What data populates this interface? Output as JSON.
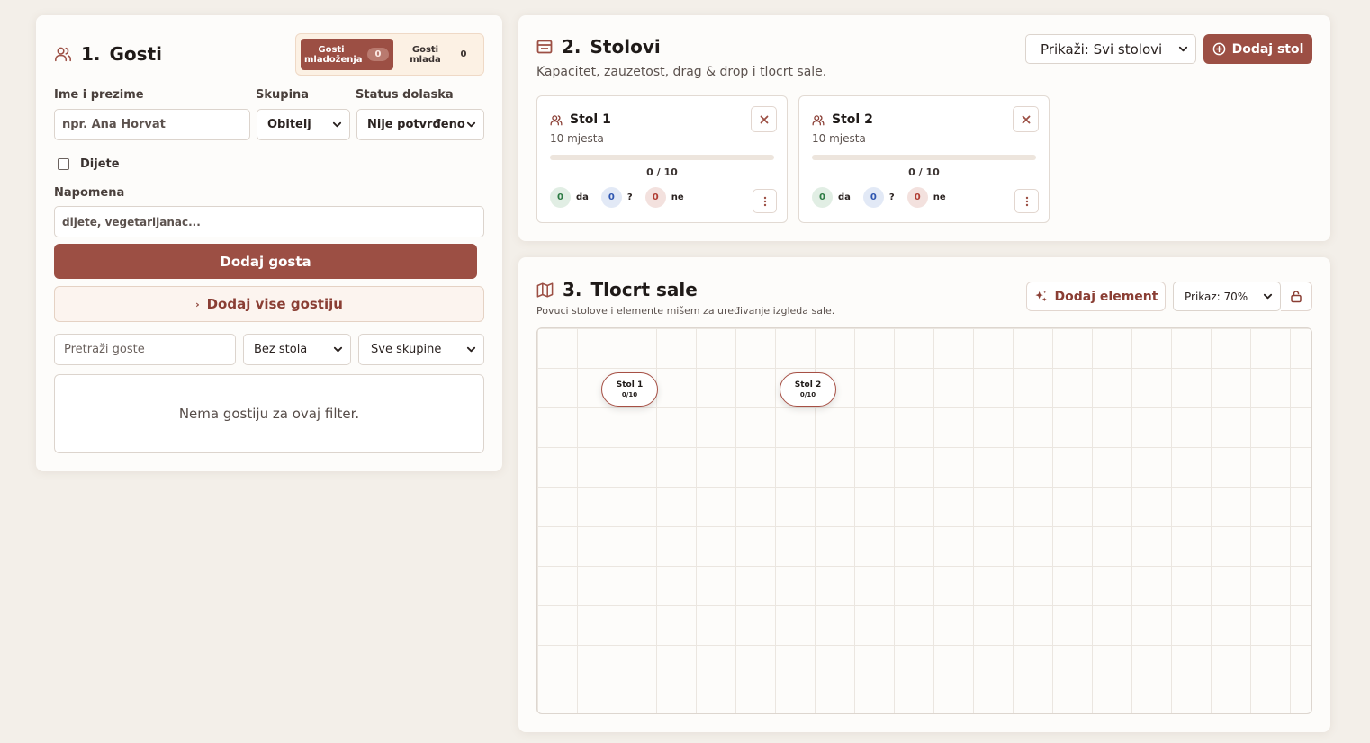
{
  "guests": {
    "number": "1.",
    "title": "Gosti",
    "tabs": [
      {
        "label": "Gosti mladoženja",
        "count": "0"
      },
      {
        "label": "Gosti mlada",
        "count": "0"
      }
    ],
    "name_label": "Ime i prezime",
    "name_placeholder": "npr. Ana Horvat",
    "group_label": "Skupina",
    "group_value": "Obitelj",
    "status_label": "Status dolaska",
    "status_value": "Nije potvrđeno",
    "child_label": "Dijete",
    "note_label": "Napomena",
    "note_placeholder": "dijete, vegetarijanac...",
    "add_button": "Dodaj gosta",
    "add_multiple_button": "Dodaj vise gostiju",
    "search_placeholder": "Pretraži goste",
    "table_filter": "Bez stola",
    "group_filter": "Sve skupine",
    "empty_text": "Nema gostiju za ovaj filter."
  },
  "tables": {
    "number": "2.",
    "title": "Stolovi",
    "subtitle": "Kapacitet, zauzetost, drag & drop i tlocrt sale.",
    "filter": "Prikaži: Svi stolovi",
    "add_button": "Dodaj stol",
    "items": [
      {
        "name": "Stol 1",
        "seats": "10 mjesta",
        "occupancy": "0 / 10",
        "fill": 0,
        "yes": "0",
        "yes_label": "da",
        "maybe": "0",
        "maybe_label": "?",
        "no": "0",
        "no_label": "ne"
      },
      {
        "name": "Stol 2",
        "seats": "10 mjesta",
        "occupancy": "0 / 10",
        "fill": 0,
        "yes": "0",
        "yes_label": "da",
        "maybe": "0",
        "maybe_label": "?",
        "no": "0",
        "no_label": "ne"
      }
    ]
  },
  "plan": {
    "number": "3.",
    "title": "Tlocrt sale",
    "subtitle": "Povuci stolove i elemente mišem za uređivanje izgleda sale.",
    "add_element_button": "Dodaj element",
    "zoom": "Prikaz: 70%",
    "tables": [
      {
        "name": "Stol 1",
        "occupancy": "0/10"
      },
      {
        "name": "Stol 2",
        "occupancy": "0/10"
      }
    ]
  },
  "colors": {
    "accent": "#9c4f44",
    "background": "#f3efe9",
    "card": "#fdfcfa"
  }
}
